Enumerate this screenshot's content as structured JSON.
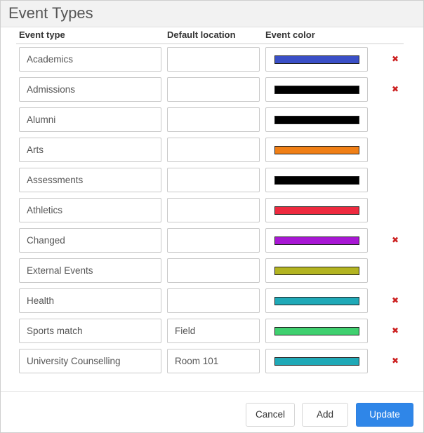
{
  "dialog": {
    "title": "Event Types"
  },
  "columns": {
    "event_type": "Event type",
    "default_location": "Default location",
    "event_color": "Event color"
  },
  "rows": [
    {
      "type": "Academics",
      "location": "",
      "color": "#3a4fc6",
      "deletable": true
    },
    {
      "type": "Admissions",
      "location": "",
      "color": "#000000",
      "deletable": true
    },
    {
      "type": "Alumni",
      "location": "",
      "color": "#000000",
      "deletable": false
    },
    {
      "type": "Arts",
      "location": "",
      "color": "#f07f16",
      "deletable": false
    },
    {
      "type": "Assessments",
      "location": "",
      "color": "#000000",
      "deletable": false
    },
    {
      "type": "Athletics",
      "location": "",
      "color": "#ee2a3f",
      "deletable": false
    },
    {
      "type": "Changed",
      "location": "",
      "color": "#a817d4",
      "deletable": true
    },
    {
      "type": "External Events",
      "location": "",
      "color": "#b3b421",
      "deletable": false
    },
    {
      "type": "Health",
      "location": "",
      "color": "#1fa9b7",
      "deletable": true
    },
    {
      "type": "Sports match",
      "location": "Field",
      "color": "#3fd06f",
      "deletable": true
    },
    {
      "type": "University Counselling",
      "location": "Room 101",
      "color": "#1fa9b7",
      "deletable": true
    }
  ],
  "icons": {
    "delete": "✖"
  },
  "footer": {
    "cancel_label": "Cancel",
    "add_label": "Add",
    "update_label": "Update"
  }
}
